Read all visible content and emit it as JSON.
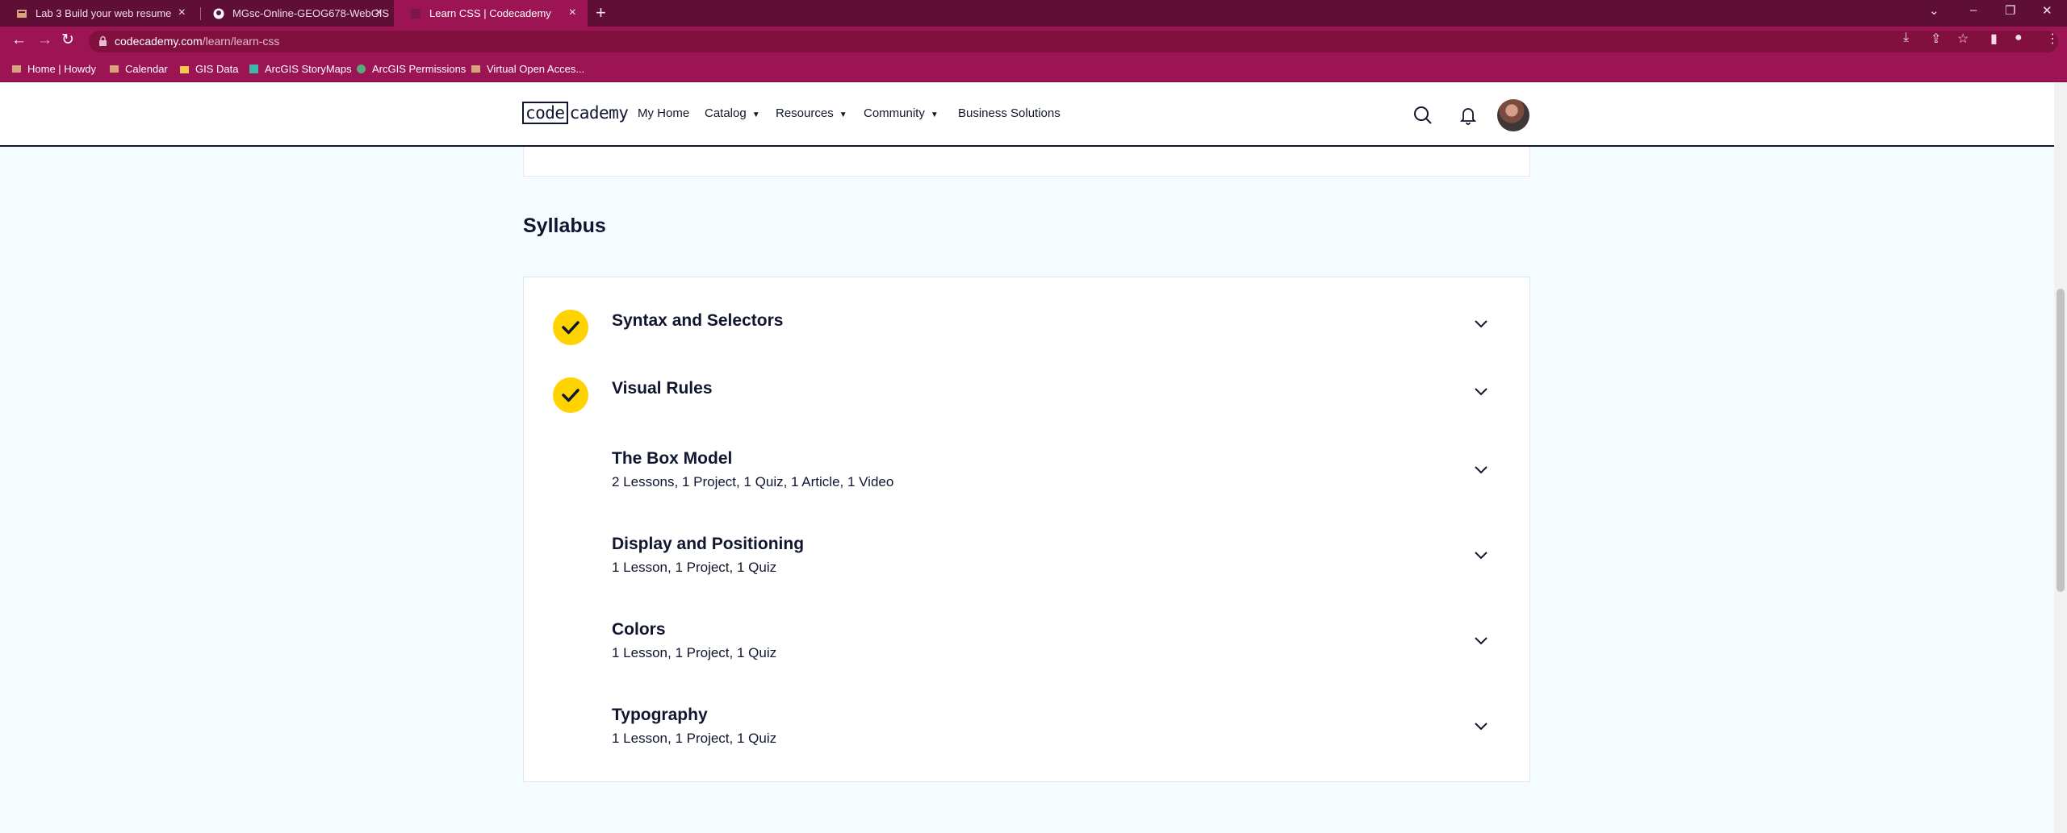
{
  "browser": {
    "tabs": [
      {
        "title": "Lab 3 Build your web resume",
        "active": false
      },
      {
        "title": "MGsc-Online-GEOG678-WebGIS",
        "active": false
      },
      {
        "title": "Learn CSS | Codecademy",
        "active": true
      }
    ],
    "url_host": "codecademy.com",
    "url_path": "/learn/learn-css",
    "bookmarks": [
      {
        "label": "Home | Howdy",
        "icon": "tamu-icon"
      },
      {
        "label": "Calendar",
        "icon": "tamu-icon"
      },
      {
        "label": "GIS Data",
        "icon": "folder-icon"
      },
      {
        "label": "ArcGIS StoryMaps",
        "icon": "storymaps-icon"
      },
      {
        "label": "ArcGIS Permissions",
        "icon": "globe-icon"
      },
      {
        "label": "Virtual Open Acces...",
        "icon": "tamu-icon"
      }
    ]
  },
  "site": {
    "logo_code": "code",
    "logo_rest": "cademy",
    "nav": [
      {
        "label": "My Home",
        "dropdown": false
      },
      {
        "label": "Catalog",
        "dropdown": true
      },
      {
        "label": "Resources",
        "dropdown": true
      },
      {
        "label": "Community",
        "dropdown": true
      },
      {
        "label": "Business Solutions",
        "dropdown": false
      }
    ]
  },
  "syllabus": {
    "title": "Syllabus",
    "modules": [
      {
        "title": "Syntax and Selectors",
        "subtitle": "",
        "completed": true
      },
      {
        "title": "Visual Rules",
        "subtitle": "",
        "completed": true
      },
      {
        "title": "The Box Model",
        "subtitle": "2 Lessons, 1 Project, 1 Quiz, 1 Article, 1 Video",
        "completed": false
      },
      {
        "title": "Display and Positioning",
        "subtitle": "1 Lesson, 1 Project, 1 Quiz",
        "completed": false
      },
      {
        "title": "Colors",
        "subtitle": "1 Lesson, 1 Project, 1 Quiz",
        "completed": false
      },
      {
        "title": "Typography",
        "subtitle": "1 Lesson, 1 Project, 1 Quiz",
        "completed": false
      }
    ]
  },
  "colors": {
    "tab_strip": "#5f0f36",
    "toolbar": "#9c1454",
    "check_badge": "#ffd300",
    "ink": "#10162f",
    "page_bg": "#f5fcff"
  }
}
